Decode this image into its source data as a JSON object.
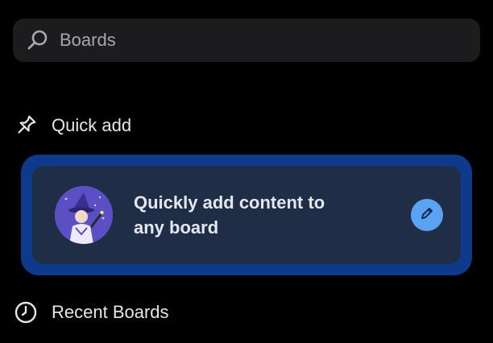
{
  "search": {
    "placeholder": "Boards",
    "icon": "search-icon"
  },
  "quick_add": {
    "header_label": "Quick add",
    "header_icon": "pin-icon",
    "card_text": "Quickly add content to any board",
    "edit_icon": "pencil-icon",
    "illustration": "wizard-illustration"
  },
  "recent_boards": {
    "header_label": "Recent Boards",
    "header_icon": "clock-icon"
  },
  "colors": {
    "background": "#000000",
    "search_bg": "#1c1c1f",
    "card_outer": "#0e3a8c",
    "card_inner": "#1f2d47",
    "accent": "#5aa2f2",
    "illustration_bg": "#5b4fc4"
  }
}
